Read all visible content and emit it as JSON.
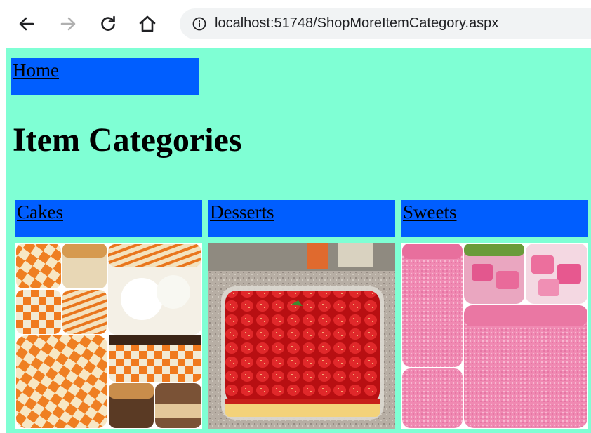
{
  "browser": {
    "url_host": "localhost",
    "url_rest": ":51748/ShopMoreItemCategory.aspx"
  },
  "page": {
    "home_link": "Home",
    "title": "Item Categories",
    "categories": [
      {
        "label": "Cakes",
        "image": "cakes-collage"
      },
      {
        "label": "Desserts",
        "image": "strawberry-dessert"
      },
      {
        "label": "Sweets",
        "image": "pink-sweets-collage"
      }
    ]
  },
  "colors": {
    "page_background": "#7fffd4",
    "link_box": "#005eff"
  }
}
